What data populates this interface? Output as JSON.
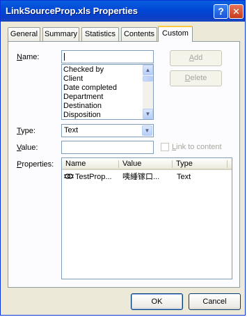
{
  "window": {
    "title": "LinkSourceProp.xls Properties",
    "help_glyph": "?",
    "close_glyph": "✕"
  },
  "tabs": [
    {
      "label": "General"
    },
    {
      "label": "Summary"
    },
    {
      "label": "Statistics"
    },
    {
      "label": "Contents"
    },
    {
      "label": "Custom",
      "active": true
    }
  ],
  "name_field": {
    "label_ul": "N",
    "label_rest": "ame:",
    "value": ""
  },
  "name_list": {
    "items": [
      "Checked by",
      "Client",
      "Date completed",
      "Department",
      "Destination",
      "Disposition"
    ]
  },
  "add_button": {
    "label_ul": "A",
    "label_rest": "dd"
  },
  "delete_button": {
    "label_ul": "D",
    "label_rest": "elete"
  },
  "type_field": {
    "label_ul": "T",
    "label_rest": "ype:",
    "value": "Text"
  },
  "value_field": {
    "label_ul": "V",
    "label_rest": "alue:",
    "value": ""
  },
  "link_checkbox": {
    "label_ul": "L",
    "label_rest": "ink to content",
    "checked": false
  },
  "properties": {
    "label_ul": "P",
    "label_rest": "roperties:",
    "columns": [
      "Name",
      "Value",
      "Type"
    ],
    "rows": [
      {
        "name": "TestProp...",
        "value": "咦綞镓口...",
        "type": "Text"
      }
    ]
  },
  "ok_button": {
    "label": "OK"
  },
  "cancel_button": {
    "label": "Cancel"
  },
  "colors": {
    "title_bar": "#0a5fdf",
    "dialog_bg": "#ece9d8",
    "panel_bg": "#fcfcfe",
    "tab_highlight": "#ffc83c"
  }
}
